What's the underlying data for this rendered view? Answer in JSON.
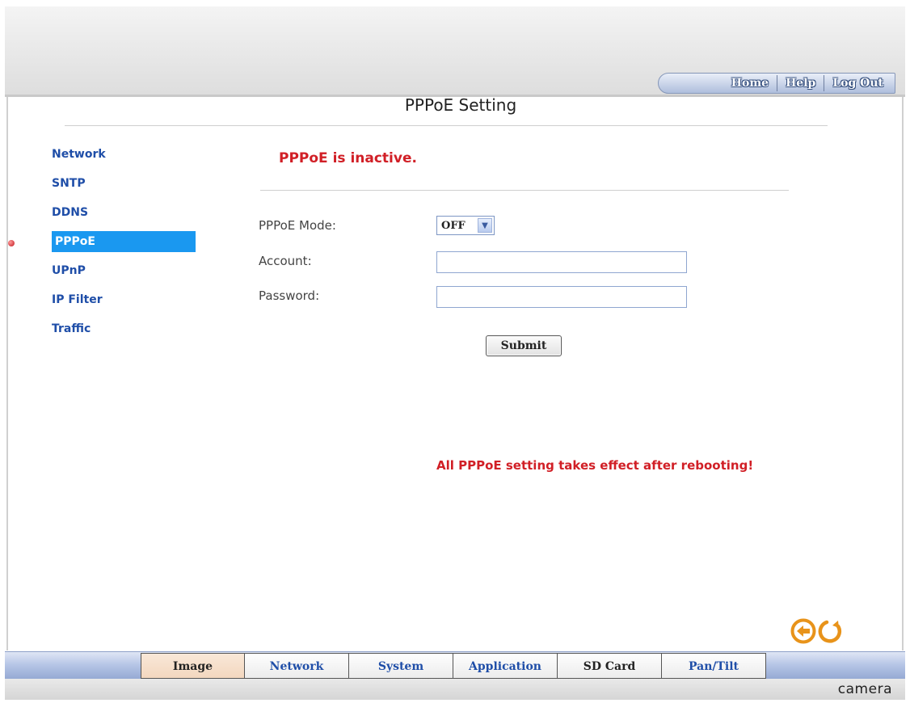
{
  "header": {
    "nav": [
      "Home",
      "Help",
      "Log Out"
    ]
  },
  "page": {
    "title": "PPPoE Setting",
    "status": "PPPoE is inactive.",
    "notice": "All PPPoE setting takes effect after rebooting!"
  },
  "sidebar": {
    "items": [
      "Network",
      "SNTP",
      "DDNS",
      "PPPoE",
      "UPnP",
      "IP Filter",
      "Traffic"
    ],
    "active_index": 3
  },
  "form": {
    "mode_label": "PPPoE Mode:",
    "mode_value": "OFF",
    "account_label": "Account:",
    "account_value": "",
    "password_label": "Password:",
    "password_value": "",
    "submit_label": "Submit"
  },
  "bottom_tabs": [
    "Image",
    "Network",
    "System",
    "Application",
    "SD Card",
    "Pan/Tilt"
  ],
  "footer": {
    "brand": "camera"
  },
  "colors": {
    "accent": "#1a98f0",
    "alert": "#d11f26",
    "link": "#1f4ea8"
  },
  "icons": [
    "back-arrow-icon",
    "refresh-icon",
    "chevron-down-icon",
    "bullet-icon"
  ]
}
